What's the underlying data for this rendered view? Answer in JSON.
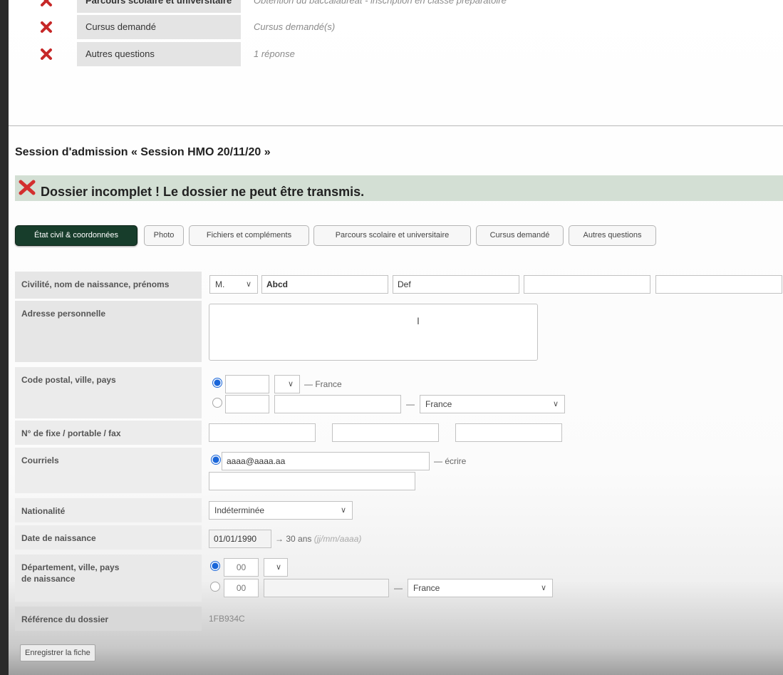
{
  "sections": [
    {
      "label": "Parcours scolaire et universitaire",
      "value": "Obtention du baccalauréat - inscription en classe préparatoire"
    },
    {
      "label": "Cursus demandé",
      "value": "Cursus demandé(s)"
    },
    {
      "label": "Autres questions",
      "value": "1 réponse"
    }
  ],
  "session_title": "Session d'admission « Session HMO 20/11/20 »",
  "banner": {
    "text": "Dossier incomplet ! Le dossier ne peut être transmis.",
    "color": "#d32f2f"
  },
  "tabs": [
    "État civil & coordonnées",
    "Photo",
    "Fichiers et compléments",
    "Parcours scolaire et universitaire",
    "Cursus demandé",
    "Autres questions"
  ],
  "form": {
    "civility": {
      "label": "Civilité, nom de naissance, prénoms",
      "title": "M.",
      "last_name": "Abcd",
      "first_name": "Def",
      "extra1": "",
      "extra2": ""
    },
    "address": {
      "label": "Adresse personnelle",
      "value": ""
    },
    "postal": {
      "label": "Code postal, ville, pays",
      "france_suffix": "— France",
      "country": "France",
      "dash": "—"
    },
    "phones": {
      "label": "N° de fixe / portable / fax"
    },
    "emails": {
      "label": "Courriels",
      "primary": "aaaa@aaaa.aa",
      "write_link": "— écrire"
    },
    "nationality": {
      "label": "Nationalité",
      "value": "Indéterminée"
    },
    "birthdate": {
      "label": "Date de naissance",
      "value": "01/01/1990",
      "age": "→ 30 ans",
      "format_hint": "(jj/mm/aaaa)"
    },
    "birthplace": {
      "label_line1": "Département, ville, pays",
      "label_line2": "de naissance",
      "dept1": "00",
      "dept2": "00",
      "dash": "—",
      "country": "France"
    },
    "reference": {
      "label": "Référence du dossier",
      "value": "1FB934C"
    }
  },
  "save_button": "Enregistrer la fiche",
  "accent_color": "#173d2b"
}
